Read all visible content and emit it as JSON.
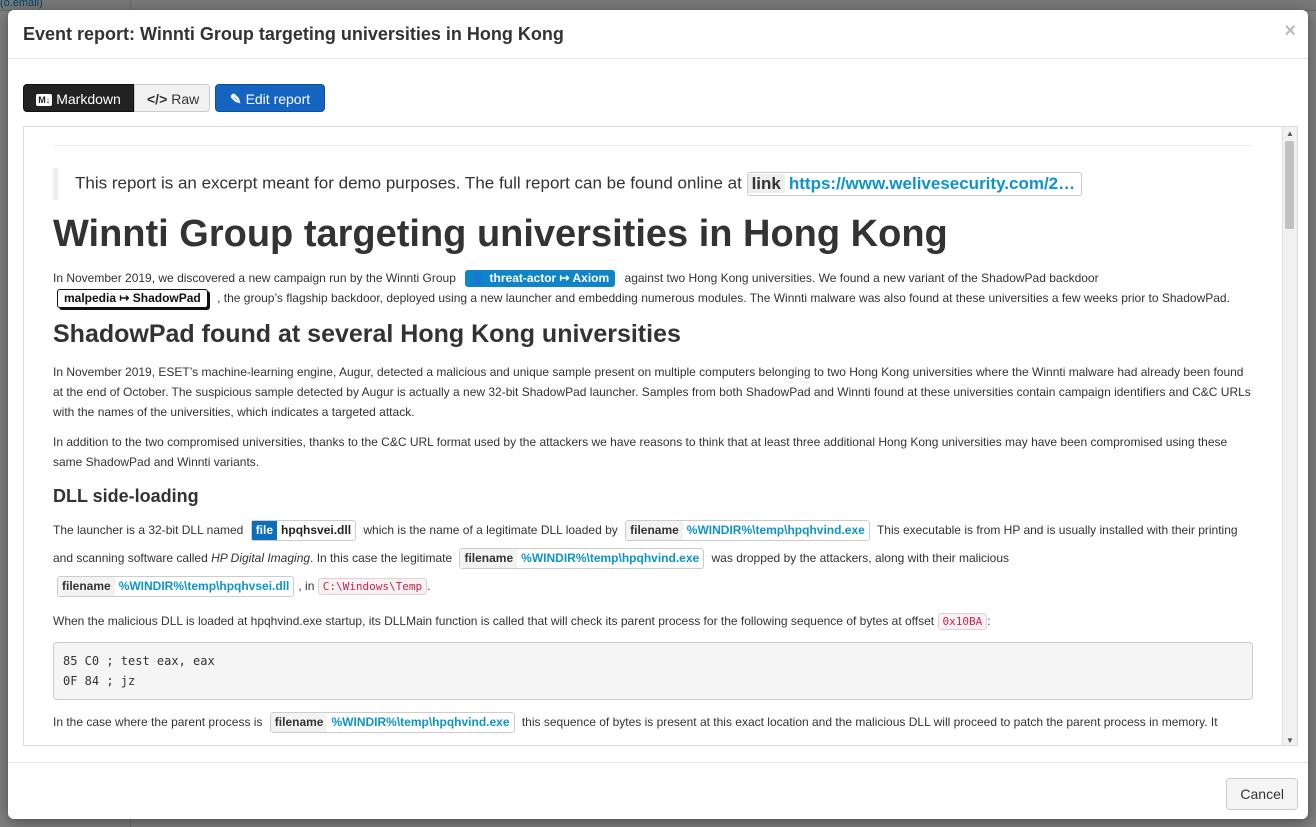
{
  "background": {
    "link_text": "(o.email)"
  },
  "modal": {
    "title": "Event report: Winnti Group targeting universities in Hong Kong",
    "close_label": "×"
  },
  "toolbar": {
    "markdown_badge": "M↓",
    "markdown_label": "Markdown",
    "raw_icon": "</>",
    "raw_label": "Raw",
    "edit_icon": "✎",
    "edit_label": "Edit report"
  },
  "report": {
    "quote_text": "This report is an excerpt meant for demo purposes. The full report can be found online at",
    "quote_link_key": "link",
    "quote_link_value": "https://www.welivesecurity.com/2…",
    "h1": "Winnti Group targeting universities in Hong Kong",
    "p1_a": "In November 2019, we discovered a new campaign run by the Winnti Group",
    "p1_galaxy1": "threat-actor ↦ Axiom",
    "p1_b": "against two Hong Kong universities. We found a new variant of the ShadowPad backdoor",
    "p1_galaxy2": "malpedia ↦ ShadowPad",
    "p1_c": ", the group’s flagship backdoor, deployed using a new launcher and embedding numerous modules. The Winnti malware was also found at these universities a few weeks prior to ShadowPad.",
    "h2": "ShadowPad found at several Hong Kong universities",
    "p2": "In November 2019, ESET’s machine-learning engine, Augur, detected a malicious and unique sample present on multiple computers belonging to two Hong Kong universities where the Winnti malware had already been found at the end of October. The suspicious sample detected by Augur is actually a new 32-bit ShadowPad launcher. Samples from both ShadowPad and Winnti found at these universities contain campaign identifiers and C&C URLs with the names of the universities, which indicates a targeted attack.",
    "p3": "In addition to the two compromised universities, thanks to the C&C URL format used by the attackers we have reasons to think that at least three additional Hong Kong universities may have been compromised using these same ShadowPad and Winnti variants.",
    "h3": "DLL side-loading",
    "p4_a": "The launcher is a 32-bit DLL named",
    "p4_attr1_k": "file",
    "p4_attr1_v": "hpqhsvei.dll",
    "p4_b": "which is the name of a legitimate DLL loaded by",
    "p4_attr2_k": "filename",
    "p4_attr2_v": "%WINDIR%\\temp\\hpqhvind.exe",
    "p4_c": "This executable is from HP and is usually installed with their printing and scanning software called",
    "p4_em": "HP Digital Imaging",
    "p4_d": ". In this case the legitimate",
    "p4_attr3_k": "filename",
    "p4_attr3_v": "%WINDIR%\\temp\\hpqhvind.exe",
    "p4_e": "was dropped by the attackers, along with their malicious",
    "p4_attr4_k": "filename",
    "p4_attr4_v": "%WINDIR%\\temp\\hpqhvsei.dll",
    "p4_f": ", in",
    "p4_code": "C:\\Windows\\Temp",
    "p4_g": ".",
    "p5_a": "When the malicious DLL is loaded at hpqhvind.exe startup, its DLLMain function is called that will check its parent process for the following sequence of bytes at offset",
    "p5_code": "0x10BA",
    "p5_b": ":",
    "code_block": "85 C0 ; test eax, eax\n0F 84 ; jz",
    "p6_a": "In the case where the parent process is",
    "p6_attr_k": "filename",
    "p6_attr_v": "%WINDIR%\\temp\\hpqhvind.exe",
    "p6_b": "this sequence of bytes is present at this exact location and the malicious DLL will proceed to patch the parent process in memory. It"
  },
  "footer": {
    "cancel_label": "Cancel"
  }
}
